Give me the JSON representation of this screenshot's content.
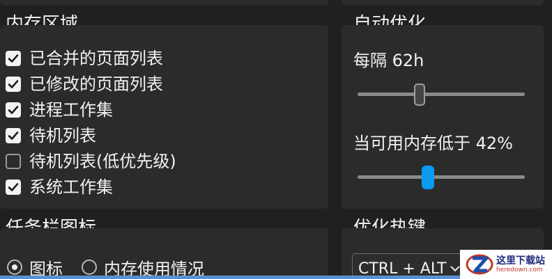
{
  "memory_areas": {
    "title": "内存区域",
    "items": [
      {
        "label": "已合并的页面列表",
        "checked": true
      },
      {
        "label": "已修改的页面列表",
        "checked": true
      },
      {
        "label": "进程工作集",
        "checked": true
      },
      {
        "label": "待机列表",
        "checked": true
      },
      {
        "label": "待机列表(低优先级)",
        "checked": false
      },
      {
        "label": "系统工作集",
        "checked": true
      }
    ]
  },
  "auto_optimize": {
    "title": "自动优化",
    "interval_label": "每隔 62h",
    "interval_value_fraction": 0.37,
    "threshold_label": "当可用内存低于 42%",
    "threshold_value_percent": 42
  },
  "taskbar_icon": {
    "title": "任务栏图标",
    "options": [
      {
        "label": "图标",
        "selected": true
      },
      {
        "label": "内存使用情况",
        "selected": false
      }
    ]
  },
  "hotkey": {
    "title": "优化热键",
    "value": "CTRL + ALT"
  },
  "watermark": {
    "main": "这里下载站",
    "sub": "heredown.com"
  },
  "colors": {
    "accent": "#0a9bef",
    "panel": "#2b2b2b",
    "background": "#202020"
  }
}
